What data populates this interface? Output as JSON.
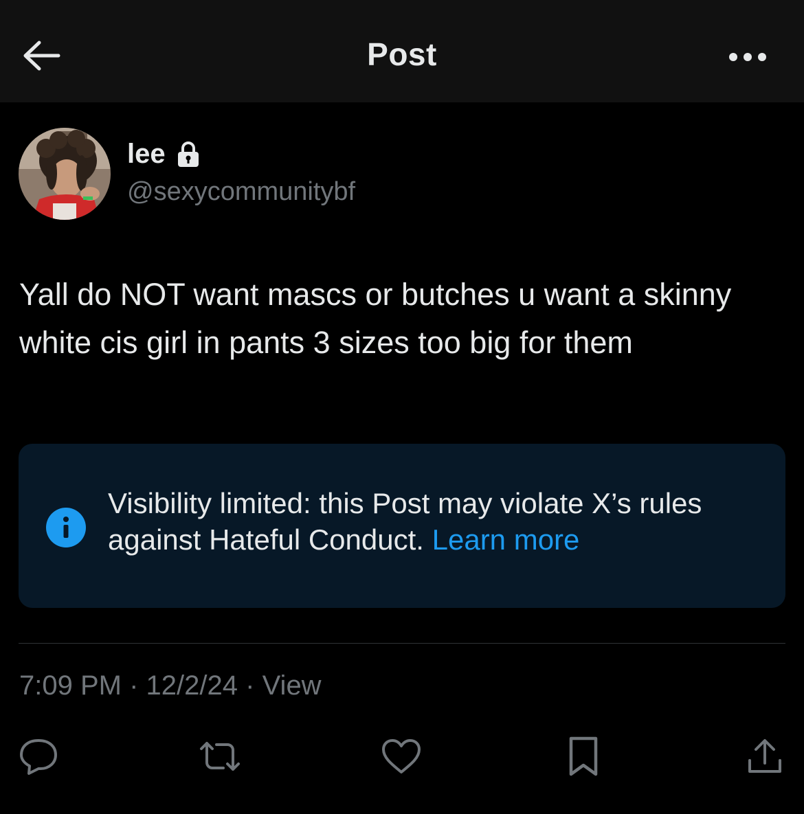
{
  "header": {
    "title": "Post",
    "back_icon": "arrow-left-icon",
    "more_icon": "more-horizontal-icon"
  },
  "author": {
    "display_name": "lee",
    "handle": "@sexycommunitybf",
    "protected_icon": "lock-icon"
  },
  "post": {
    "text": "Yall do NOT want mascs or butches u want a skinny white cis girl in pants 3 sizes too big for them"
  },
  "notice": {
    "icon": "info-icon",
    "text": "Visibility limited: this Post may violate X’s rules against Hateful Conduct.",
    "link_label": "Learn more"
  },
  "meta": {
    "time": "7:09 PM",
    "separator": "·",
    "date": "12/2/24",
    "views_label": "View"
  },
  "actions": [
    {
      "icon": "reply-icon"
    },
    {
      "icon": "repost-icon"
    },
    {
      "icon": "like-icon"
    },
    {
      "icon": "bookmark-icon"
    },
    {
      "icon": "share-icon"
    }
  ],
  "colors": {
    "background": "#000000",
    "header_background": "#111111",
    "text_primary": "#e7e9ea",
    "text_secondary": "#71767b",
    "accent": "#1d9bf0",
    "notice_background": "#071827",
    "divider": "#2f3336"
  }
}
